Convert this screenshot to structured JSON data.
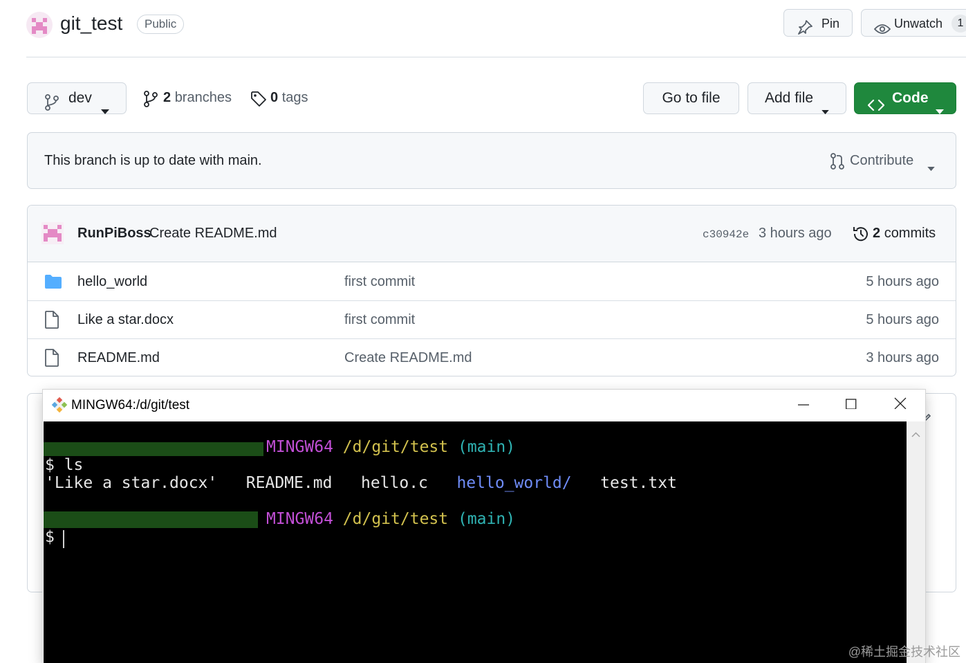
{
  "header": {
    "repo_name": "git_test",
    "visibility": "Public",
    "pin_label": "Pin",
    "unwatch_label": "Unwatch",
    "watch_count": "1"
  },
  "branch_bar": {
    "current_branch": "dev",
    "branches_count": "2",
    "branches_label": "branches",
    "tags_count": "0",
    "tags_label": "tags",
    "go_to_file": "Go to file",
    "add_file": "Add file",
    "code": "Code"
  },
  "status": {
    "message": "This branch is up to date with main.",
    "contribute": "Contribute"
  },
  "latest_commit": {
    "author": "RunPiBoss",
    "message": "Create README.md",
    "sha": "c30942e",
    "time": "3 hours ago",
    "commits_count": "2",
    "commits_label": "commits"
  },
  "files": [
    {
      "name": "hello_world",
      "type": "folder",
      "commit": "first commit",
      "time": "5 hours ago"
    },
    {
      "name": "Like a star.docx",
      "type": "file",
      "commit": "first commit",
      "time": "5 hours ago"
    },
    {
      "name": "README.md",
      "type": "file",
      "commit": "Create README.md",
      "time": "3 hours ago"
    }
  ],
  "terminal": {
    "title": "MINGW64:/d/git/test",
    "prompt1": {
      "system": "MINGW64",
      "path": "/d/git/test",
      "branch": "(main)"
    },
    "cmd": "$ ls",
    "ls_output": {
      "docx": "'Like a star.docx'",
      "readme": "README.md",
      "helloc": "hello.c",
      "dir": "hello_world/",
      "txt": "test.txt"
    },
    "prompt2": {
      "system": "MINGW64",
      "path": "/d/git/test",
      "branch": "(main)"
    },
    "prompt_symbol": "$"
  },
  "watermark": "@稀土掘金技术社区",
  "colors": {
    "code_button": "#1f883d",
    "folder_icon": "#54aeff",
    "mingw": "#c24fd6",
    "path": "#d2c14e",
    "branch": "#2fb3b3",
    "dir": "#6f8cf7"
  }
}
